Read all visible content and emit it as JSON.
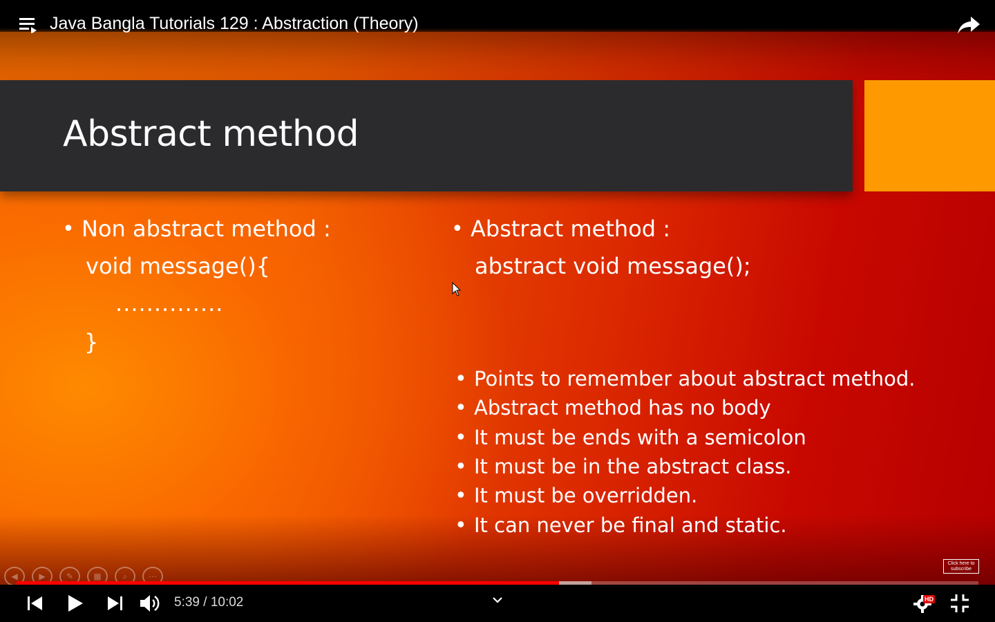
{
  "player": {
    "title": "Java Bangla Tutorials 129 : Abstraction (Theory)",
    "time_current": "5:39",
    "time_total": "10:02",
    "time_display": "5:39 / 10:02",
    "progress_played_fraction": 0.564,
    "progress_buffered_fraction": 0.598,
    "hd_label": "HD",
    "accent_color": "#ff0000"
  },
  "slide": {
    "title": "Abstract method",
    "left": {
      "heading": "Non abstract method :",
      "code_line1": "void message(){",
      "code_line2": "..............",
      "code_line3": "}"
    },
    "right": {
      "heading": "Abstract method :",
      "code_line1": "abstract void message();"
    },
    "points": [
      "Points to remember about abstract method.",
      "Abstract method has no body",
      "It must be ends with a semicolon",
      "It must be in the abstract class.",
      "It must be overridden.",
      "It can never be final and static."
    ],
    "subscribe_label": "Click here to subscribe",
    "colors": {
      "title_band": "#2b2b2d",
      "accent_block": "#fe9a00",
      "background_orange": "#f26a00",
      "background_red": "#b50000"
    }
  },
  "icons": {
    "playlist": "playlist-icon",
    "share": "share-icon",
    "previous": "skip-previous-icon",
    "play": "play-icon",
    "next": "skip-next-icon",
    "volume": "volume-icon",
    "chevron": "chevron-down-icon",
    "settings": "gear-icon",
    "exit_fullscreen": "exit-fullscreen-icon"
  }
}
